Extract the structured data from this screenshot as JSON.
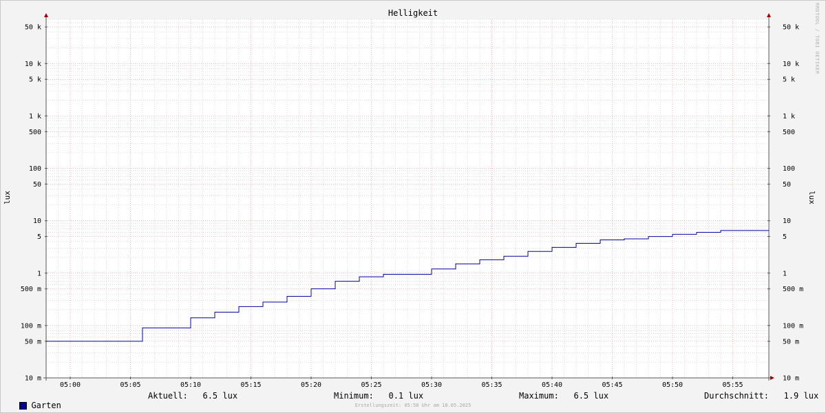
{
  "chart_data": {
    "type": "line",
    "title": "Helligkeit",
    "ylabel_left": "lux",
    "ylabel_right": "lux",
    "y_scale": "log",
    "ylim": [
      0.01,
      70000
    ],
    "y_ticks": [
      {
        "value": 0.01,
        "label": "10 m"
      },
      {
        "value": 0.05,
        "label": "50 m"
      },
      {
        "value": 0.1,
        "label": "100 m"
      },
      {
        "value": 0.5,
        "label": "500 m"
      },
      {
        "value": 1,
        "label": "1"
      },
      {
        "value": 5,
        "label": "5"
      },
      {
        "value": 10,
        "label": "10"
      },
      {
        "value": 50,
        "label": "50"
      },
      {
        "value": 100,
        "label": "100"
      },
      {
        "value": 500,
        "label": "500"
      },
      {
        "value": 1000,
        "label": "1 k"
      },
      {
        "value": 5000,
        "label": "5 k"
      },
      {
        "value": 10000,
        "label": "10 k"
      },
      {
        "value": 50000,
        "label": "50 k"
      }
    ],
    "xlim": [
      "04:58",
      "05:58"
    ],
    "x_ticks": [
      "05:00",
      "05:05",
      "05:10",
      "05:15",
      "05:20",
      "05:25",
      "05:30",
      "05:35",
      "05:40",
      "05:45",
      "05:50",
      "05:55"
    ],
    "grid": true,
    "series": [
      {
        "name": "Garten",
        "color": "#0000a0",
        "points": [
          [
            "04:58",
            0.05
          ],
          [
            "05:06",
            0.09
          ],
          [
            "05:10",
            0.14
          ],
          [
            "05:12",
            0.18
          ],
          [
            "05:14",
            0.23
          ],
          [
            "05:16",
            0.28
          ],
          [
            "05:18",
            0.36
          ],
          [
            "05:20",
            0.5
          ],
          [
            "05:22",
            0.7
          ],
          [
            "05:24",
            0.85
          ],
          [
            "05:26",
            0.95
          ],
          [
            "05:30",
            1.2
          ],
          [
            "05:32",
            1.5
          ],
          [
            "05:34",
            1.8
          ],
          [
            "05:36",
            2.1
          ],
          [
            "05:38",
            2.6
          ],
          [
            "05:40",
            3.1
          ],
          [
            "05:42",
            3.7
          ],
          [
            "05:44",
            4.3
          ],
          [
            "05:46",
            4.5
          ],
          [
            "05:48",
            5.0
          ],
          [
            "05:50",
            5.5
          ],
          [
            "05:52",
            6.0
          ],
          [
            "05:54",
            6.5
          ],
          [
            "05:58",
            6.5
          ]
        ]
      }
    ]
  },
  "legend": {
    "series_name": "Garten",
    "aktuell": "Aktuell:   6.5 lux",
    "minimum": "Minimum:   0.1 lux",
    "maximum": "Maximum:   6.5 lux",
    "durchschnitt": "Durchschnitt:   1.9 lux"
  },
  "footer": "Erstellungszeit: 05:58 Uhr am 18.05.2025",
  "watermark": "RRDTOOL / TOBI OETIKER",
  "colors": {
    "major_grid": "#e8a0a0",
    "minor_grid": "#c8c8c8",
    "series": "#0000a0",
    "axis_arrow": "#a00000"
  }
}
